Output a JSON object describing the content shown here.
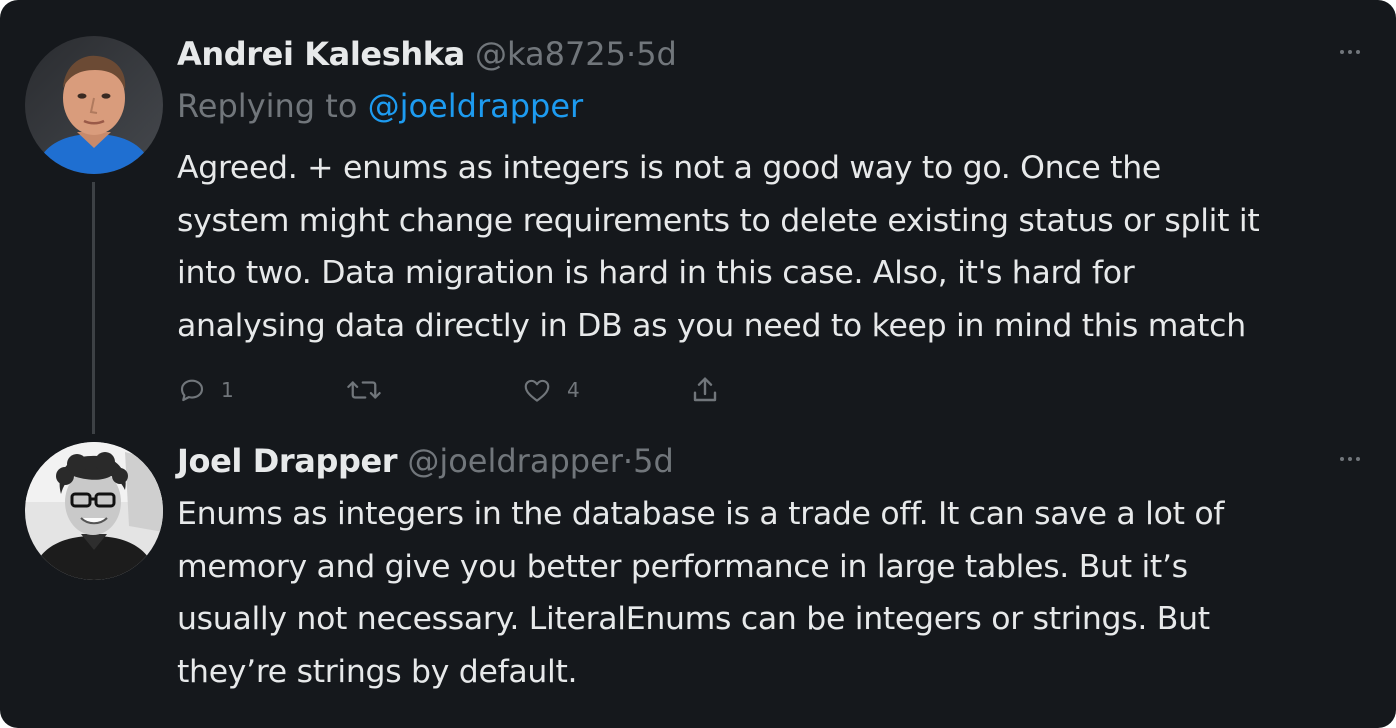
{
  "tweets": [
    {
      "name": "Andrei Kaleshka",
      "handle": "@ka8725",
      "separator": "·",
      "time": "5d",
      "replying_prefix": "Replying to",
      "replying_to": "@joeldrapper",
      "lines": [
        "Agreed. + enums as integers is not a good way to go. Once the",
        "system might change requirements to delete existing status or split it",
        "into two. Data migration is hard in this case. Also, it's hard for",
        "analysing data directly in DB as you need to keep in mind this match"
      ],
      "actions": {
        "reply_count": "1",
        "retweet_count": "",
        "like_count": "4"
      },
      "icons": [
        "reply-icon",
        "retweet-icon",
        "like-icon",
        "share-icon",
        "more-icon"
      ]
    },
    {
      "name": "Joel Drapper",
      "handle": "@joeldrapper",
      "separator": "·",
      "time": "5d",
      "lines": [
        "Enums as integers in the database is a trade off. It can save a lot of",
        "memory and give you better performance in large tables. But it’s",
        "usually not necessary. LiteralEnums can be integers or strings. But",
        "they’re strings by default."
      ],
      "icons": [
        "more-icon"
      ]
    }
  ],
  "colors": {
    "background": "#15181c",
    "primary_text": "#e7e9ea",
    "secondary_text": "#71767b",
    "accent": "#1d9bf0",
    "thread_line": "#3d4145"
  }
}
